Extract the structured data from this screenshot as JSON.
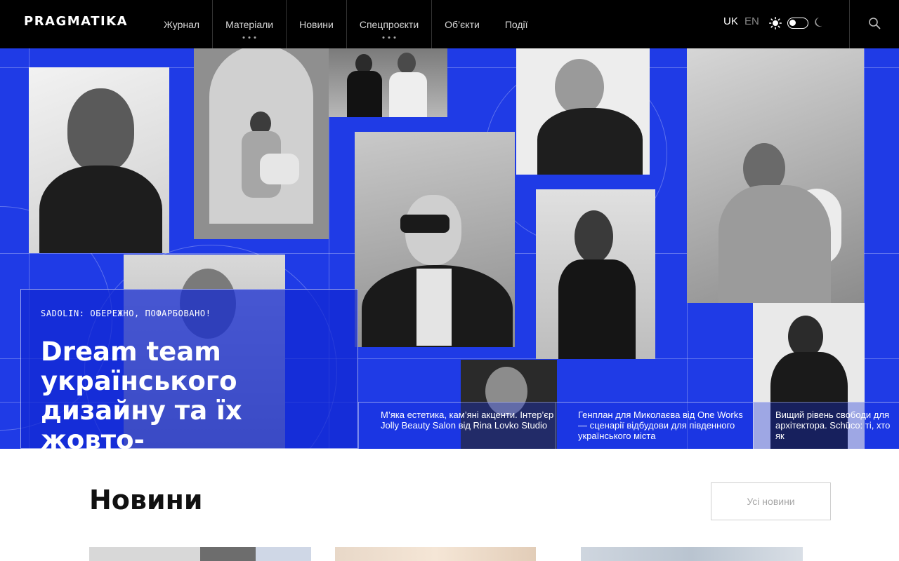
{
  "header": {
    "logo": "PRAGMATIKA",
    "nav": [
      {
        "label": "Журнал",
        "has_more": false
      },
      {
        "label": "Матеріали",
        "has_more": true
      },
      {
        "label": "Новини",
        "has_more": false
      },
      {
        "label": "Спецпроєкти",
        "has_more": true
      },
      {
        "label": "Об’єкти",
        "has_more": false
      },
      {
        "label": "Події",
        "has_more": false
      }
    ],
    "languages": {
      "active": "UK",
      "inactive": "EN"
    },
    "icons": {
      "theme_light": "sun-icon",
      "theme_toggle": "toggle-switch",
      "theme_dark": "moon-icon",
      "search": "search-icon"
    }
  },
  "hero": {
    "feature": {
      "kicker": "SADOLIN: ОБЕРЕЖНО, ПОФАРБОВАНО!",
      "headline": "Dream team українського дизайну та їх жовто-"
    },
    "stories": [
      {
        "title": "М’яка естетика, кам’яні акценти. Інтер’єр Jolly Beauty Salon від Rina Lovko Studio"
      },
      {
        "title": "Генплан для Миколаєва від One Works — сценарії відбудови для південного українського міста"
      },
      {
        "title": "Вищий рівень свободи для архітектора. Schüco: ті, хто як"
      }
    ]
  },
  "news": {
    "title": "Новини",
    "all_button": "Усі новини"
  },
  "colors": {
    "header_bg": "#000000",
    "hero_blue": "#1f3be6",
    "text_on_dark": "#ffffff",
    "muted": "#a6a6a6"
  }
}
